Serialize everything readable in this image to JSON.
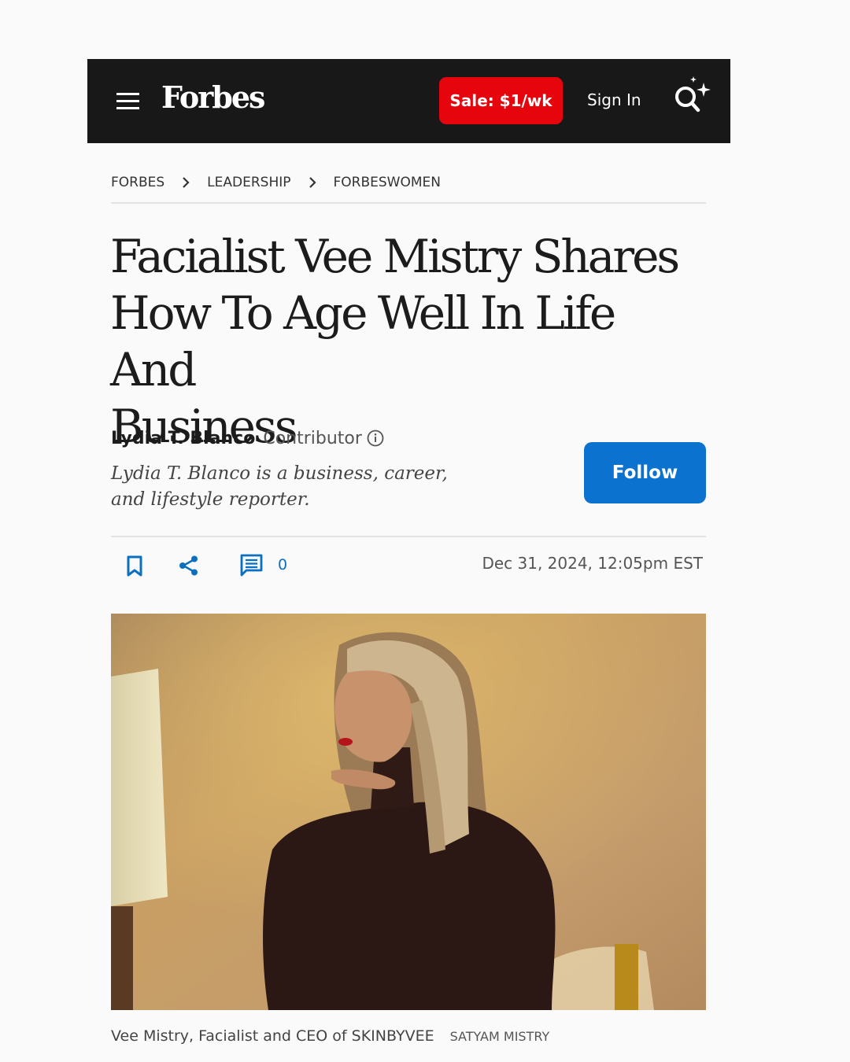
{
  "header": {
    "logo": "Forbes",
    "sale_label": "Sale: $1/wk",
    "signin_label": "Sign In",
    "menu_icon": "hamburger-menu-icon",
    "search_icon": "search-sparkle-icon",
    "colors": {
      "bar": "#181818",
      "sale": "#e6050c"
    }
  },
  "breadcrumb": [
    "FORBES",
    "LEADERSHIP",
    "FORBESWOMEN"
  ],
  "article": {
    "headline_lines": [
      "Facialist Vee Mistry Shares",
      "How To Age Well In Life And",
      "Business"
    ],
    "author": {
      "name": "Lydia T. Blanco",
      "role": "Contributor",
      "bio_lines": [
        "Lydia T. Blanco is a business, career,",
        "and lifestyle reporter."
      ],
      "follow_label": "Follow"
    },
    "actions": {
      "comment_count": "0"
    },
    "date": "Dec 31, 2024, 12:05pm EST",
    "image": {
      "caption": "Vee Mistry, Facialist and CEO of SKINBYVEE",
      "credit": "SATYAM MISTRY"
    }
  },
  "colors": {
    "accent": "#0b72cf",
    "icon_blue": "#0b6fc0"
  }
}
